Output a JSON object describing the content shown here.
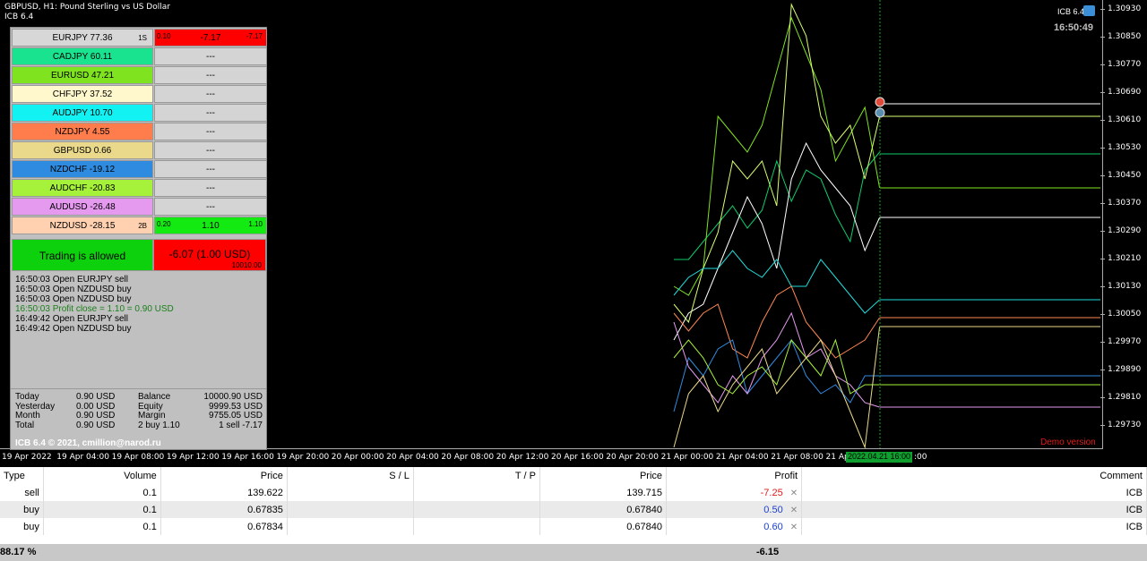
{
  "chart": {
    "title_line1": "GBPUSD, H1:  Pound Sterling vs US Dollar",
    "title_line2": "ICB 6.4",
    "version": "ICB 6.4",
    "clock": "16:50:49",
    "demo": "Demo version",
    "y_labels": [
      "1.30930",
      "1.30850",
      "1.30770",
      "1.30690",
      "1.30610",
      "1.30530",
      "1.30450",
      "1.30370",
      "1.30290",
      "1.30210",
      "1.30130",
      "1.30050",
      "1.29970",
      "1.29890",
      "1.29810",
      "1.29730"
    ],
    "x_labels": [
      "19 Apr 2022",
      "19 Apr 04:00",
      "19 Apr 08:00",
      "19 Apr 12:00",
      "19 Apr 16:00",
      "19 Apr 20:00",
      "20 Apr 00:00",
      "20 Apr 04:00",
      "20 Apr 08:00",
      "20 Apr 12:00",
      "20 Apr 16:00",
      "20 Apr 20:00",
      "21 Apr 00:00",
      "21 Apr 04:00",
      "21 Apr 08:00",
      "21 Ap"
    ],
    "x_cursor": "2022.04.21 16:00",
    "x_tail": ":00",
    "colors": {
      "up": "#1ca21c",
      "down": "#e01b1b"
    }
  },
  "panel": {
    "pairs": [
      {
        "name": "EURJPY",
        "value": "77.36",
        "badge": "1S",
        "color": "#d7d7d7",
        "cell": "-7.17",
        "cell_left": "0.10",
        "cell_right": "-7.17",
        "cell_color": "#ff0000"
      },
      {
        "name": "CADJPY",
        "value": "60.11",
        "badge": "",
        "color": "#19e38f",
        "cell": "---",
        "cell_color": "#d4d4d4"
      },
      {
        "name": "EURUSD",
        "value": "47.21",
        "badge": "",
        "color": "#7fe31f",
        "cell": "---",
        "cell_color": "#d4d4d4"
      },
      {
        "name": "CHFJPY",
        "value": "37.52",
        "badge": "",
        "color": "#fff8cc",
        "cell": "---",
        "cell_color": "#d4d4d4"
      },
      {
        "name": "AUDJPY",
        "value": "10.70",
        "badge": "",
        "color": "#12f2f2",
        "cell": "---",
        "cell_color": "#d4d4d4"
      },
      {
        "name": "NZDJPY",
        "value": "4.55",
        "badge": "",
        "color": "#ff7c4d",
        "cell": "---",
        "cell_color": "#d4d4d4"
      },
      {
        "name": "GBPUSD",
        "value": "0.66",
        "badge": "",
        "color": "#ead98a",
        "cell": "---",
        "cell_color": "#d4d4d4"
      },
      {
        "name": "NZDCHF",
        "value": "-19.12",
        "badge": "",
        "color": "#2f8be0",
        "cell": "---",
        "cell_color": "#d4d4d4"
      },
      {
        "name": "AUDCHF",
        "value": "-20.83",
        "badge": "",
        "color": "#a6f23a",
        "cell": "---",
        "cell_color": "#d4d4d4"
      },
      {
        "name": "AUDUSD",
        "value": "-26.48",
        "badge": "",
        "color": "#e59af0",
        "cell": "---",
        "cell_color": "#d4d4d4"
      },
      {
        "name": "NZDUSD",
        "value": "-28.15",
        "badge": "2B",
        "color": "#ffd1b0",
        "cell": "1.10",
        "cell_left": "0.20",
        "cell_right": "1.10",
        "cell_color": "#12ea12"
      }
    ],
    "trading_status": "Trading is allowed",
    "pl_main": "-6.07 (1.00 USD)",
    "pl_sub": "10010.00",
    "log": [
      {
        "text": "16:50:03 Open EURJPY sell",
        "green": false
      },
      {
        "text": "16:50:03 Open NZDUSD buy",
        "green": false
      },
      {
        "text": "16:50:03 Open NZDUSD buy",
        "green": false
      },
      {
        "text": "16:50:03 Profit close = 1.10 = 0.90 USD",
        "green": true
      },
      {
        "text": "16:49:42 Open EURJPY sell",
        "green": false
      },
      {
        "text": "16:49:42 Open NZDUSD buy",
        "green": false
      }
    ],
    "stats": [
      [
        "Today",
        "0.90 USD",
        "Balance",
        "10000.90 USD"
      ],
      [
        "Yesterday",
        "0.00 USD",
        "Equity",
        "9999.53 USD"
      ],
      [
        "Month",
        "0.90 USD",
        "Margin",
        "9755.05 USD"
      ],
      [
        "Total",
        "0.90 USD",
        "2 buy 1.10",
        "1 sell -7.17"
      ]
    ],
    "copyright": "ICB 6.4 © 2021, cmillion@narod.ru"
  },
  "trades": {
    "headers": [
      "Type",
      "Volume",
      "Price",
      "S / L",
      "T / P",
      "Price",
      "Profit",
      "Comment"
    ],
    "rows": [
      {
        "type": "sell",
        "volume": "0.1",
        "price": "139.622",
        "sl": "",
        "tp": "",
        "cur": "139.715",
        "profit": "-7.25",
        "sign": "neg",
        "comment": "ICB"
      },
      {
        "type": "buy",
        "volume": "0.1",
        "price": "0.67835",
        "sl": "",
        "tp": "",
        "cur": "0.67840",
        "profit": "0.50",
        "sign": "pos",
        "comment": "ICB"
      },
      {
        "type": "buy",
        "volume": "0.1",
        "price": "0.67834",
        "sl": "",
        "tp": "",
        "cur": "0.67840",
        "profit": "0.60",
        "sign": "pos",
        "comment": "ICB"
      }
    ],
    "footer_left": "88.17 %",
    "footer_profit": "-6.15"
  }
}
